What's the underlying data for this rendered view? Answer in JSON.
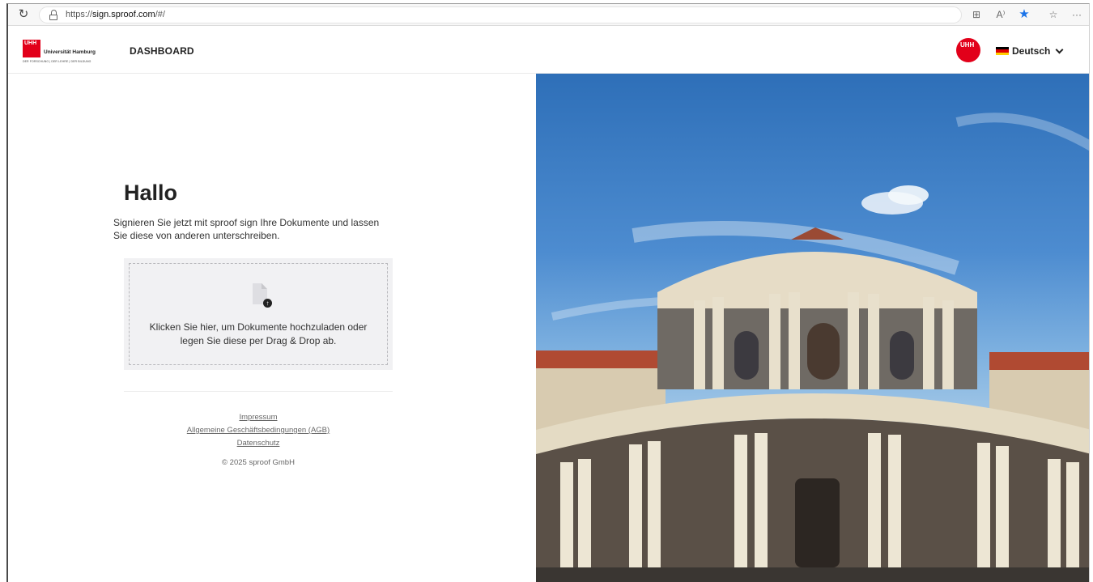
{
  "browser": {
    "url_prefix": "https://",
    "url_host": "sign.sproof.com",
    "url_path": "/#/"
  },
  "header": {
    "logo_mark": "UHH",
    "logo_name": "Universität Hamburg",
    "logo_tagline": "DER FORSCHUNG | DER LEHRE | DER BILDUNG",
    "nav_dashboard": "DASHBOARD",
    "avatar_mark": "UHH",
    "language": "Deutsch"
  },
  "main": {
    "title": "Hallo",
    "intro": "Signieren Sie jetzt mit sproof sign Ihre Dokumente und lassen Sie diese von anderen unterschreiben.",
    "dropzone_text": "Klicken Sie hier, um Dokumente hochzuladen oder legen Sie diese per Drag & Drop ab."
  },
  "footer": {
    "links": [
      "Impressum",
      "Allgemeine Geschäftsbedingungen (AGB)",
      "Datenschutz"
    ],
    "copyright": "© 2025 sproof GmbH"
  },
  "colors": {
    "brand_red": "#e2001a",
    "flag": [
      "#000000",
      "#dd0000",
      "#ffce00"
    ]
  },
  "icons": [
    "reload-icon",
    "lock-icon",
    "split-screen-icon",
    "read-aloud-icon",
    "star-icon",
    "favorites-icon",
    "more-icon",
    "document-upload-icon",
    "chevron-down-icon"
  ]
}
